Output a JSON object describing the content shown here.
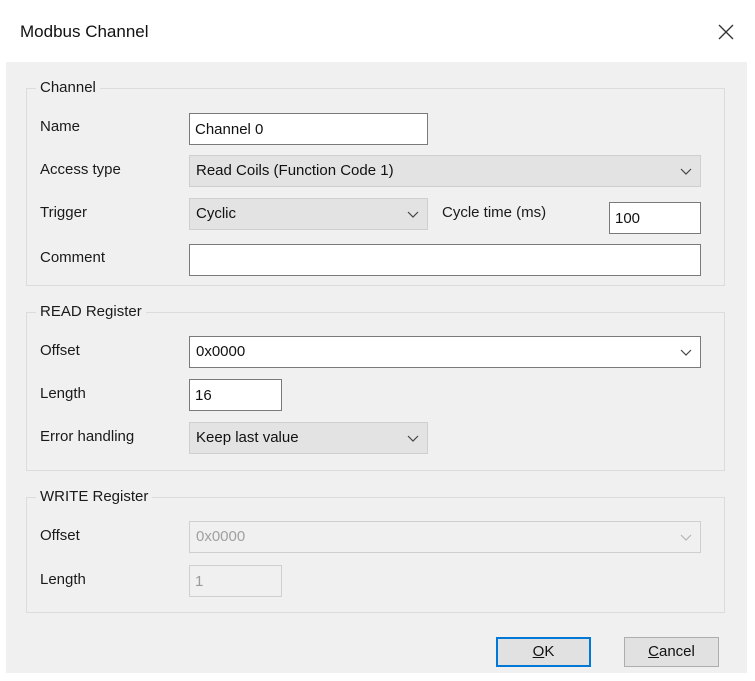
{
  "dialog": {
    "title": "Modbus Channel"
  },
  "channel": {
    "group_label": "Channel",
    "name_label": "Name",
    "name_value": "Channel 0",
    "access_type_label": "Access type",
    "access_type_value": "Read Coils (Function Code 1)",
    "trigger_label": "Trigger",
    "trigger_value": "Cyclic",
    "cycle_time_label": "Cycle time (ms)",
    "cycle_time_value": "100",
    "comment_label": "Comment",
    "comment_value": ""
  },
  "read_register": {
    "group_label": "READ Register",
    "offset_label": "Offset",
    "offset_value": "0x0000",
    "length_label": "Length",
    "length_value": "16",
    "error_handling_label": "Error handling",
    "error_handling_value": "Keep last value"
  },
  "write_register": {
    "group_label": "WRITE Register",
    "offset_label": "Offset",
    "offset_value": "0x0000",
    "length_label": "Length",
    "length_value": "1"
  },
  "buttons": {
    "ok_mnemonic": "O",
    "ok_rest": "K",
    "cancel_mnemonic": "C",
    "cancel_rest": "ancel"
  },
  "colors": {
    "default_button_border": "#0078d7",
    "dialog_background": "#f0f0f0"
  }
}
